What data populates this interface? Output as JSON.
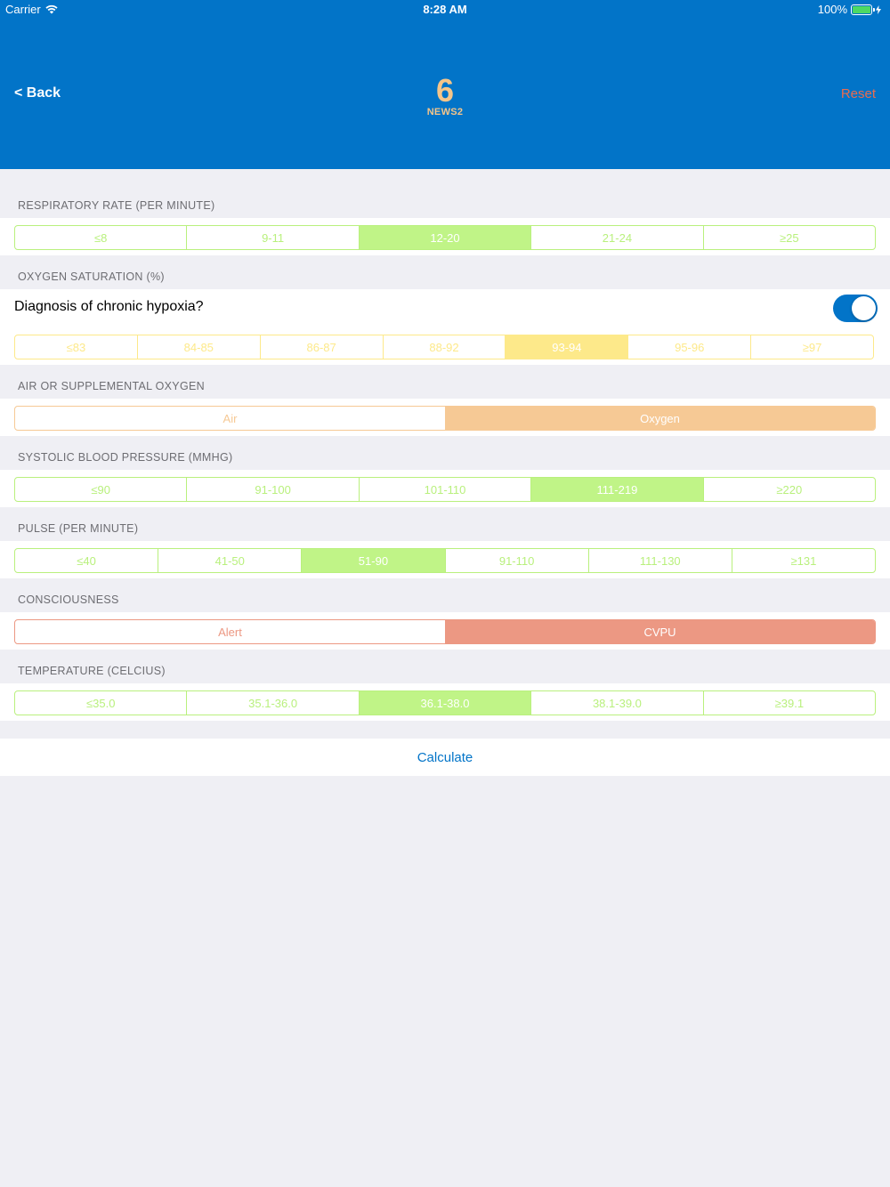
{
  "status_bar": {
    "carrier": "Carrier",
    "time": "8:28 AM",
    "battery": "100%"
  },
  "nav": {
    "back_label": "< Back",
    "score": "6",
    "score_label": "NEWS2",
    "reset_label": "Reset"
  },
  "sections": {
    "respiratory": {
      "title": "RESPIRATORY RATE (PER MINUTE)",
      "options": [
        "≤8",
        "9-11",
        "12-20",
        "21-24",
        "≥25"
      ],
      "selected": "12-20"
    },
    "oxygen_sat": {
      "title": "OXYGEN SATURATION (%)",
      "hypoxia_label": "Diagnosis of chronic hypoxia?",
      "hypoxia_on": true,
      "options": [
        "≤83",
        "84-85",
        "86-87",
        "88-92",
        "93-94",
        "95-96",
        "≥97"
      ],
      "selected": "93-94"
    },
    "air_oxygen": {
      "title": "AIR OR SUPPLEMENTAL OXYGEN",
      "options": [
        "Air",
        "Oxygen"
      ],
      "selected": "Oxygen"
    },
    "systolic": {
      "title": "SYSTOLIC BLOOD PRESSURE (MMHG)",
      "options": [
        "≤90",
        "91-100",
        "101-110",
        "111-219",
        "≥220"
      ],
      "selected": "111-219"
    },
    "pulse": {
      "title": "PULSE (PER MINUTE)",
      "options": [
        "≤40",
        "41-50",
        "51-90",
        "91-110",
        "111-130",
        "≥131"
      ],
      "selected": "51-90"
    },
    "consciousness": {
      "title": "CONSCIOUSNESS",
      "options": [
        "Alert",
        "CVPU"
      ],
      "selected": "CVPU"
    },
    "temperature": {
      "title": "TEMPERATURE (CELCIUS)",
      "options": [
        "≤35.0",
        "35.1-36.0",
        "36.1-38.0",
        "38.1-39.0",
        "≥39.1"
      ],
      "selected": "36.1-38.0"
    }
  },
  "calculate_label": "Calculate",
  "colors": {
    "header": "#0274c8",
    "score": "#f5c58a",
    "reset": "#e96c4f",
    "green": "#c0f487",
    "yellow": "#fde98a",
    "orange": "#f6c995",
    "red": "#ec9883"
  }
}
